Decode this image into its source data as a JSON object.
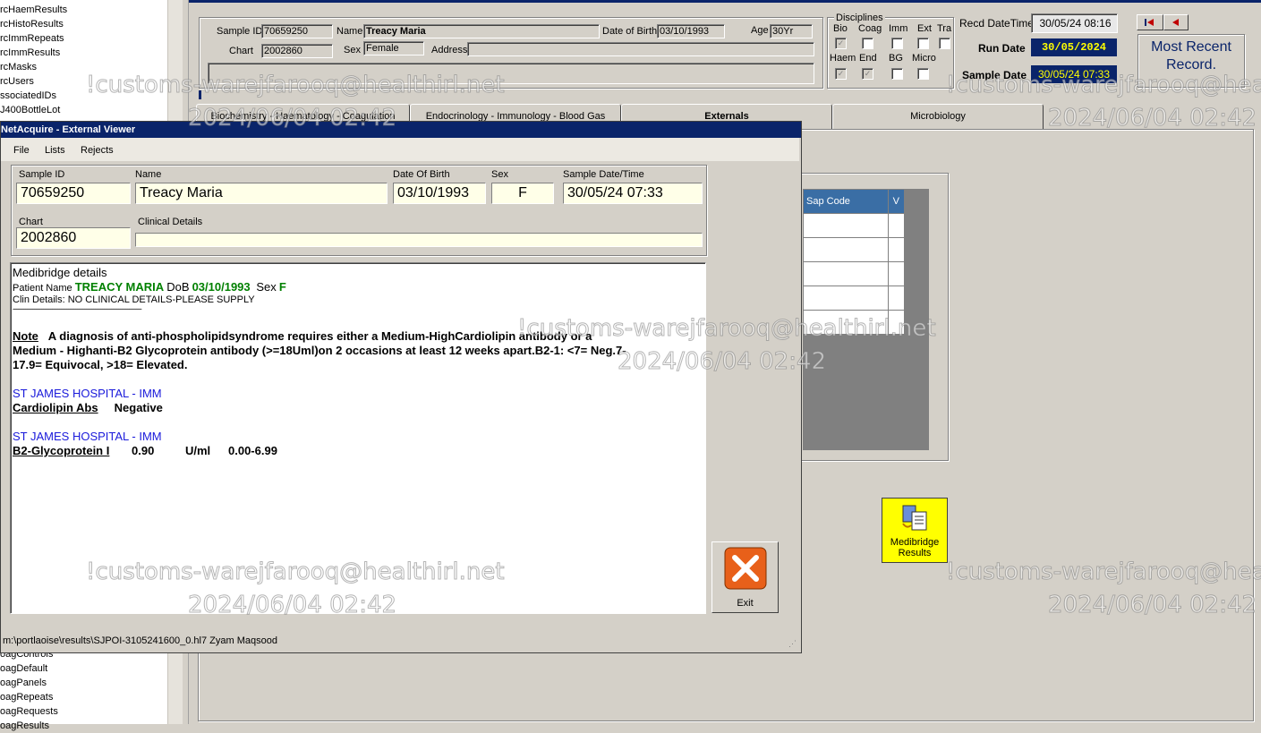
{
  "tree": {
    "items_top": [
      "rcHaemResults",
      "rcHistoResults",
      "rcImmRepeats",
      "rcImmResults",
      "rcMasks",
      "rcUsers",
      "ssociatedIDs",
      "J400BottleLot"
    ],
    "items_bottom": [
      "oagControls",
      "oagDefault",
      "oagPanels",
      "oagRepeats",
      "oagRequests",
      "oagResults"
    ]
  },
  "form": {
    "sample_id_label": "Sample ID",
    "sample_id": "70659250",
    "name_label": "Name",
    "name": "Treacy Maria",
    "dob_label": "Date of Birth",
    "dob": "03/10/1993",
    "age_label": "Age",
    "age": "30Yr",
    "chart_label": "Chart",
    "chart": "2002860",
    "sex_label": "Sex",
    "sex": "Female",
    "address_label": "Address",
    "address": "",
    "disciplines_label": "Disciplines",
    "disc_row1": [
      "Bio",
      "Coag",
      "Imm",
      "Ext",
      "Tra"
    ],
    "disc_row2": [
      "Haem",
      "End",
      "BG",
      "Micro"
    ],
    "recd_label": "Recd DateTime",
    "recd": "30/05/24 08:16",
    "run_date_label": "Run Date",
    "run_date": "30/05/2024",
    "sample_date_label": "Sample Date",
    "sample_date": "30/05/24 07:33",
    "most_recent": "Most Recent Record."
  },
  "tabs": [
    "Biochemistry - Haematology - Coagulation",
    "Endocrinology - Immunology - Blood Gas",
    "Externals",
    "Microbiology"
  ],
  "grid": {
    "col1": "Sap Code",
    "col2": "V"
  },
  "medibridge_button": "Medibridge Results",
  "dialog": {
    "title": "NetAcquire - External Viewer",
    "menu": [
      "File",
      "Lists",
      "Rejects"
    ],
    "sample_id_label": "Sample ID",
    "sample_id": "70659250",
    "name_label": "Name",
    "name": "Treacy Maria",
    "dob_label": "Date Of Birth",
    "dob": "03/10/1993",
    "sex_label": "Sex",
    "sex": "F",
    "sample_dt_label": "Sample Date/Time",
    "sample_dt": "30/05/24 07:33",
    "chart_label": "Chart",
    "chart": "2002860",
    "clinical_label": "Clinical Details",
    "clinical": "",
    "report": {
      "heading": "Medibridge details",
      "patient_prefix": "Patient Name",
      "patient_name": "TREACY MARIA",
      "dob_prefix": "DoB",
      "dob": "03/10/1993",
      "sex_prefix": "Sex",
      "sex": "F",
      "clin_details": "Clin Details: NO CLINICAL DETAILS-PLEASE SUPPLY",
      "divider": "------------------------------------------------------------------------",
      "note_label": "Note",
      "note_line1": "A diagnosis of anti-phospholipidsyndrome requires either a Medium-HighCardiolipin antibody or a",
      "note_line2": "Medium - Highanti-B2 Glycoprotein antibody (>=18Uml)on 2 occasions at least 12 weeks apart.B2-1: <7= Neg.7-",
      "note_line3": "17.9= Equivocal, >18= Elevated.",
      "lab1": "ST JAMES HOSPITAL - IMM",
      "test1": "Cardiolipin Abs",
      "result1": "Negative",
      "lab2": "ST JAMES HOSPITAL - IMM",
      "test2": "B2-Glycoprotein I",
      "result2": "0.90",
      "unit2": "U/ml",
      "range2": "0.00-6.99"
    },
    "exit_label": "Exit",
    "status": "m:\\portlaoise\\results\\SJPOI-3105241600_0.hl7  Zyam Maqsood"
  },
  "watermark": {
    "email": "!customs-warejfarooq@healthirl.net",
    "time": "2024/06/04 02:42"
  },
  "colors": {
    "title_bar": "#0a246a",
    "yellow_field": "#ffffe8",
    "report_blue": "#1a1adb",
    "report_green": "#008000",
    "button_yellow": "#ffff00",
    "grid_header": "#3a6ea5"
  }
}
